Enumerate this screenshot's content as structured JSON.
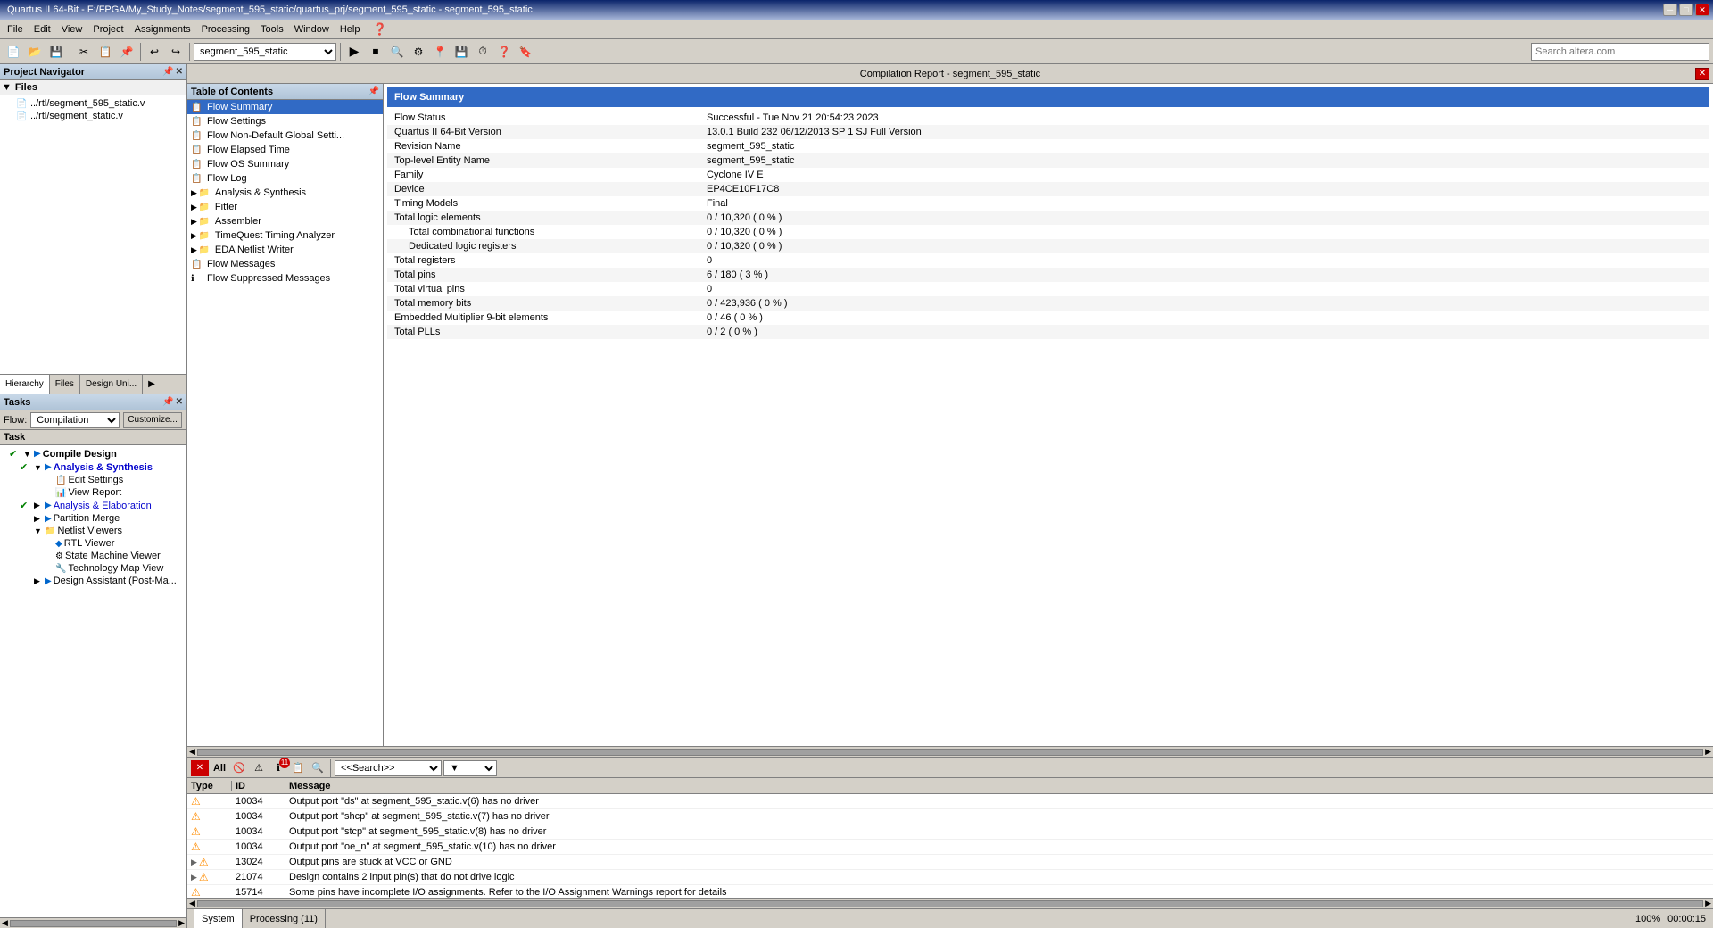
{
  "titlebar": {
    "text": "Quartus II 64-Bit - F:/FPGA/My_Study_Notes/segment_595_static/quartus_prj/segment_595_static - segment_595_static",
    "minimize": "─",
    "maximize": "□",
    "close": "✕"
  },
  "menubar": {
    "items": [
      "File",
      "Edit",
      "View",
      "Project",
      "Assignments",
      "Processing",
      "Tools",
      "Window",
      "Help"
    ]
  },
  "toolbar": {
    "select_label": "segment_595_static",
    "search_placeholder": "Search altera.com"
  },
  "project_navigator": {
    "title": "Project Navigator",
    "files": [
      {
        "name": "../rtl/segment_595_static.v",
        "icon": "📄"
      },
      {
        "name": "../rtl/segment_static.v",
        "icon": "📄"
      }
    ]
  },
  "nav_tabs": [
    "Hierarchy",
    "Files",
    "Design Uni..."
  ],
  "tasks": {
    "title": "Tasks",
    "flow_label": "Flow:",
    "flow_value": "Compilation",
    "customize_label": "Customize...",
    "column_header": "Task",
    "items": [
      {
        "indent": 1,
        "check": "✔",
        "expand": "▼",
        "icon": "▶",
        "label": "Compile Design",
        "bold": true
      },
      {
        "indent": 2,
        "check": "✔",
        "expand": "▼",
        "icon": "▶",
        "label": "Analysis & Synthesis",
        "bold": true,
        "color": "blue"
      },
      {
        "indent": 3,
        "check": "",
        "expand": "",
        "icon": "📋",
        "label": "Edit Settings"
      },
      {
        "indent": 3,
        "check": "",
        "expand": "",
        "icon": "📊",
        "label": "View Report"
      },
      {
        "indent": 2,
        "check": "✔",
        "expand": "▶",
        "icon": "▶",
        "label": "Analysis & Elaboration",
        "color": "blue"
      },
      {
        "indent": 2,
        "check": "",
        "expand": "▶",
        "icon": "▶",
        "label": "Partition Merge"
      },
      {
        "indent": 2,
        "check": "",
        "expand": "▼",
        "icon": "📁",
        "label": "Netlist Viewers"
      },
      {
        "indent": 3,
        "check": "",
        "expand": "",
        "icon": "🔷",
        "label": "RTL Viewer"
      },
      {
        "indent": 3,
        "check": "",
        "expand": "",
        "icon": "⚙",
        "label": "State Machine Viewer"
      },
      {
        "indent": 3,
        "check": "",
        "expand": "",
        "icon": "🔧",
        "label": "Technology Map View"
      },
      {
        "indent": 2,
        "check": "",
        "expand": "▶",
        "icon": "▶",
        "label": "Design Assistant (Post-Ma..."
      }
    ]
  },
  "report": {
    "title": "Compilation Report - segment_595_static",
    "toc_title": "Table of Contents",
    "toc_items": [
      {
        "label": "Flow Summary",
        "icon": "📋",
        "selected": true
      },
      {
        "label": "Flow Settings",
        "icon": "📋"
      },
      {
        "label": "Flow Non-Default Global Settings",
        "icon": "📋"
      },
      {
        "label": "Flow Elapsed Time",
        "icon": "📋"
      },
      {
        "label": "Flow OS Summary",
        "icon": "📋"
      },
      {
        "label": "Flow Log",
        "icon": "📋"
      },
      {
        "label": "Analysis & Synthesis",
        "icon": "📁",
        "expandable": true
      },
      {
        "label": "Fitter",
        "icon": "📁",
        "expandable": true
      },
      {
        "label": "Assembler",
        "icon": "📁",
        "expandable": true
      },
      {
        "label": "TimeQuest Timing Analyzer",
        "icon": "📁",
        "expandable": true
      },
      {
        "label": "EDA Netlist Writer",
        "icon": "📁",
        "expandable": true
      },
      {
        "label": "Flow Messages",
        "icon": "📋"
      },
      {
        "label": "Flow Suppressed Messages",
        "icon": "ℹ"
      }
    ],
    "section_title": "Flow Summary",
    "rows": [
      {
        "label": "Flow Status",
        "value": "Successful - Tue Nov 21 20:54:23 2023",
        "indent": 0
      },
      {
        "label": "Quartus II 64-Bit Version",
        "value": "13.0.1 Build 232 06/12/2013 SP 1 SJ Full Version",
        "indent": 0
      },
      {
        "label": "Revision Name",
        "value": "segment_595_static",
        "indent": 0
      },
      {
        "label": "Top-level Entity Name",
        "value": "segment_595_static",
        "indent": 0
      },
      {
        "label": "Family",
        "value": "Cyclone IV E",
        "indent": 0
      },
      {
        "label": "Device",
        "value": "EP4CE10F17C8",
        "indent": 0
      },
      {
        "label": "Timing Models",
        "value": "Final",
        "indent": 0
      },
      {
        "label": "Total logic elements",
        "value": "0 / 10,320 ( 0 % )",
        "indent": 0
      },
      {
        "label": "Total combinational functions",
        "value": "0 / 10,320 ( 0 % )",
        "indent": 1
      },
      {
        "label": "Dedicated logic registers",
        "value": "0 / 10,320 ( 0 % )",
        "indent": 1
      },
      {
        "label": "Total registers",
        "value": "0",
        "indent": 0
      },
      {
        "label": "Total pins",
        "value": "6 / 180 ( 3 % )",
        "indent": 0
      },
      {
        "label": "Total virtual pins",
        "value": "0",
        "indent": 0
      },
      {
        "label": "Total memory bits",
        "value": "0 / 423,936 ( 0 % )",
        "indent": 0
      },
      {
        "label": "Embedded Multiplier 9-bit elements",
        "value": "0 / 46 ( 0 % )",
        "indent": 0
      },
      {
        "label": "Total PLLs",
        "value": "0 / 2 ( 0 % )",
        "indent": 0
      }
    ]
  },
  "messages_panel": {
    "filter_options": [
      "<<Search>>"
    ],
    "headers": [
      "Type",
      "ID",
      "Message"
    ],
    "messages": [
      {
        "type": "Warning",
        "id": "10034",
        "text": "Output port \"ds\" at segment_595_static.v(6) has no driver",
        "expandable": false
      },
      {
        "type": "Warning",
        "id": "10034",
        "text": "Output port \"shcp\" at segment_595_static.v(7) has no driver",
        "expandable": false
      },
      {
        "type": "Warning",
        "id": "10034",
        "text": "Output port \"stcp\" at segment_595_static.v(8) has no driver",
        "expandable": false
      },
      {
        "type": "Warning",
        "id": "10034",
        "text": "Output port \"oe_n\" at segment_595_static.v(10) has no driver",
        "expandable": false
      },
      {
        "type": "Warning",
        "id": "13024",
        "text": "Output pins are stuck at VCC or GND",
        "expandable": true
      },
      {
        "type": "Warning",
        "id": "21074",
        "text": "Design contains 2 input pin(s) that do not drive logic",
        "expandable": true
      },
      {
        "type": "Warning",
        "id": "15714",
        "text": "Some pins have incomplete I/O assignments. Refer to the I/O Assignment Warnings report for details",
        "expandable": false
      }
    ]
  },
  "status_bar": {
    "tabs": [
      "System",
      "Processing (11)"
    ],
    "zoom": "100%",
    "time": "00:00:15"
  }
}
